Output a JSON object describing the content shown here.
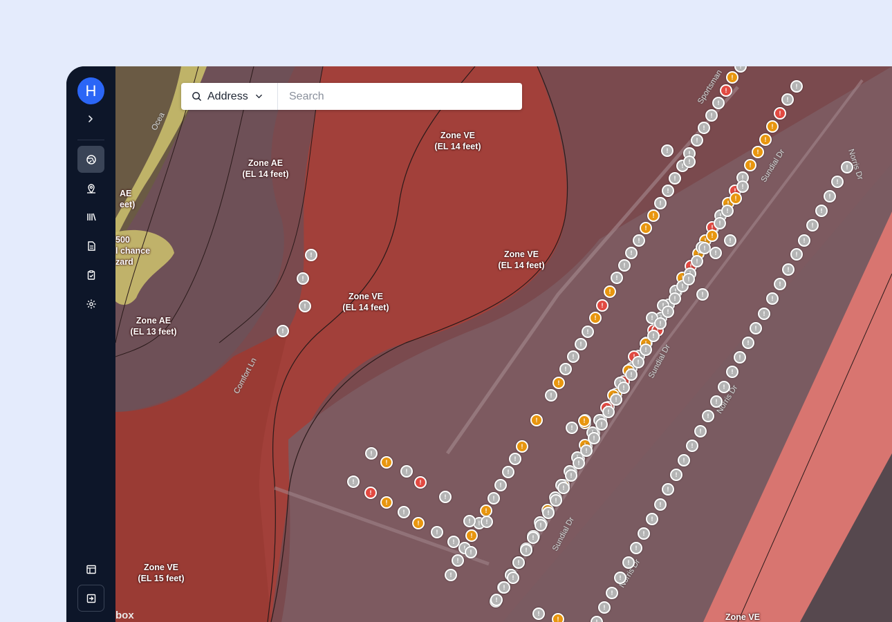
{
  "user": {
    "avatar_initial": "H"
  },
  "sidebar": {
    "items": [
      {
        "icon": "globe-icon",
        "active": true
      },
      {
        "icon": "map-pin-icon",
        "active": false
      },
      {
        "icon": "library-icon",
        "active": false
      },
      {
        "icon": "document-icon",
        "active": false
      },
      {
        "icon": "clipboard-check-icon",
        "active": false
      },
      {
        "icon": "gear-icon",
        "active": false
      }
    ],
    "bottom": [
      {
        "icon": "layout-icon"
      },
      {
        "icon": "logout-icon"
      }
    ]
  },
  "search": {
    "type_label": "Address",
    "placeholder": "Search"
  },
  "map": {
    "attribution": "box",
    "zone_labels": [
      "Zone VE\n(EL 14 feet)",
      "Zone AE\n(EL 14 feet)",
      "Zone VE\n(EL 14 feet)",
      "Zone VE\n(EL 14 feet)",
      "Zone AE\n(EL 13 feet)",
      "Zone VE\n(EL 15 feet)",
      "Zone VE",
      "AE\neet)",
      "500\nl chance\nzard"
    ],
    "street_labels": [
      "Sportsman",
      "Sundial Dr",
      "Norris Dr",
      "Comfort Ln",
      "Sundial Dr",
      "Norris Dr",
      "Sundial Dr",
      "Norris Dr",
      "Ocea"
    ],
    "marker_colors": {
      "gray": "#b4b4b4",
      "orange": "#e8960f",
      "red": "#e24a42"
    }
  }
}
